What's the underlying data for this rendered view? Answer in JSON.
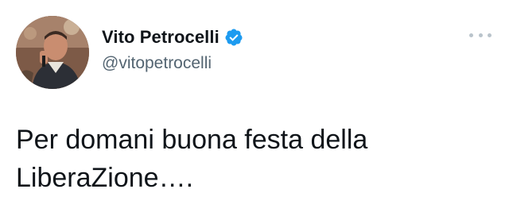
{
  "author": {
    "name": "Vito Petrocelli",
    "handle": "@vitopetrocelli",
    "verified": true,
    "avatar_icon": "avatar-photo"
  },
  "menu": {
    "icon": "more-icon"
  },
  "tweet": {
    "text_line1": "Per domani buona festa della",
    "text_line2": "LiberaZione…."
  },
  "colors": {
    "name": "#0f1419",
    "handle": "#536471",
    "verified_badge": "#1d9bf0",
    "more_dots": "#b9c3cb"
  }
}
